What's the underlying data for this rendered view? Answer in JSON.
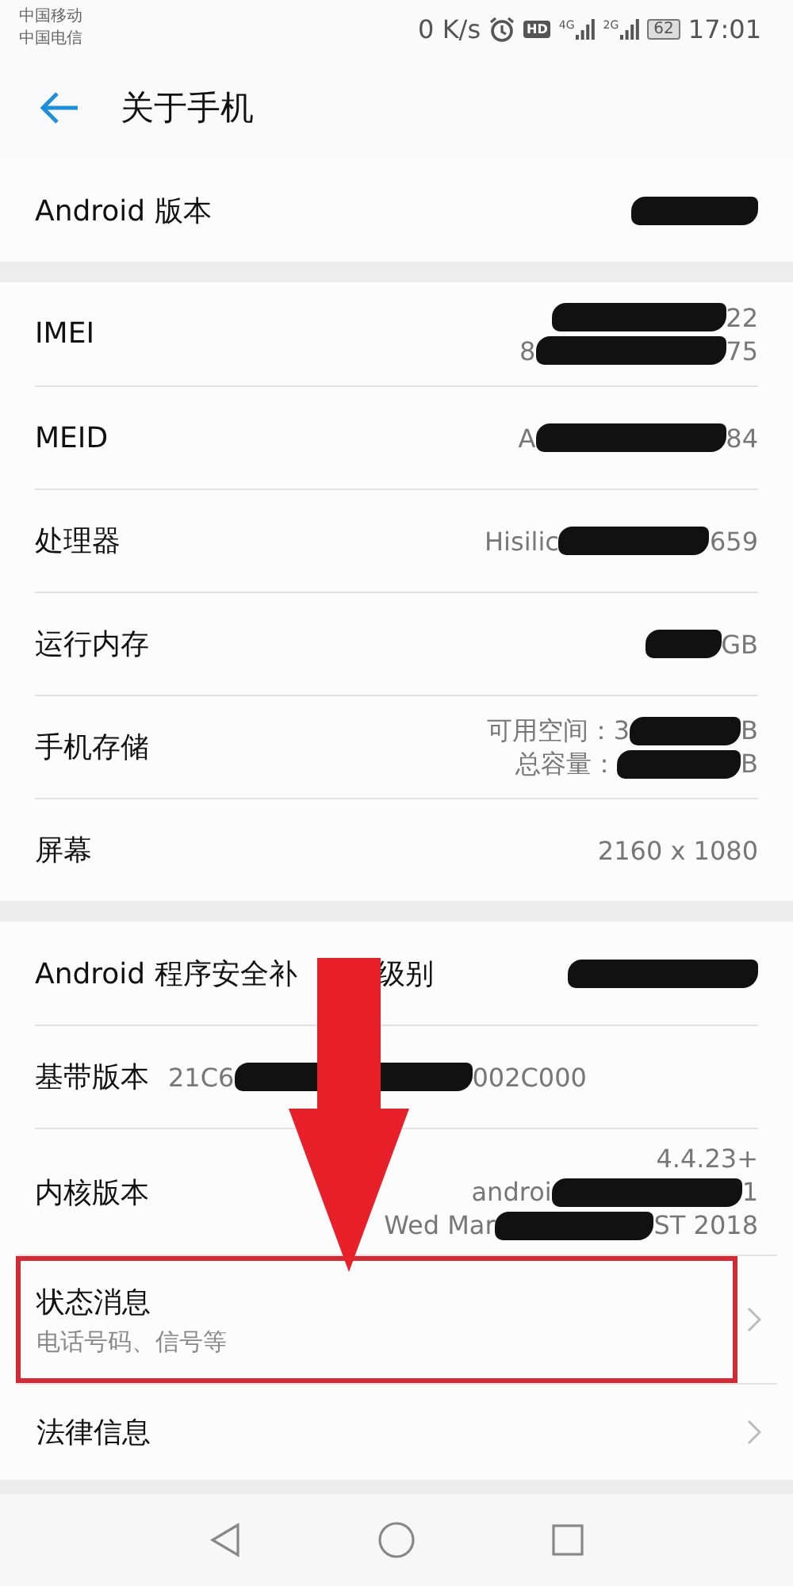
{
  "status_bar": {
    "carriers": [
      "中国移动",
      "中国电信"
    ],
    "speed": "0 K/s",
    "hd_badge": "HD",
    "networks": [
      "4G",
      "2G"
    ],
    "battery": "62",
    "time": "17:01"
  },
  "header": {
    "title": "关于手机"
  },
  "sections": [
    {
      "rows": [
        {
          "kind": "value",
          "label": [
            "Android 版本"
          ],
          "lines": [
            [
              {
                "kind": "redacted"
              }
            ]
          ]
        }
      ]
    },
    {
      "rows": [
        {
          "kind": "value",
          "label": [
            "IMEI"
          ],
          "lines": [
            [
              {
                "kind": "redacted"
              },
              {
                "kind": "text",
                "text": "22"
              }
            ],
            [
              {
                "kind": "text",
                "text": "8"
              },
              {
                "kind": "redacted"
              },
              {
                "kind": "text",
                "text": "75"
              }
            ]
          ]
        },
        {
          "kind": "value",
          "label": [
            "MEID"
          ],
          "lines": [
            [
              {
                "kind": "text",
                "text": "A"
              },
              {
                "kind": "redacted"
              },
              {
                "kind": "text",
                "text": "84"
              }
            ]
          ]
        },
        {
          "kind": "value",
          "label": [
            "处理器"
          ],
          "lines": [
            [
              {
                "kind": "text",
                "text": "Hisilic"
              },
              {
                "kind": "redacted"
              },
              {
                "kind": "text",
                "text": "659"
              }
            ]
          ]
        },
        {
          "kind": "value",
          "label": [
            "运行内存"
          ],
          "lines": [
            [
              {
                "kind": "redacted"
              },
              {
                "kind": "text",
                "text": "GB"
              }
            ]
          ]
        },
        {
          "kind": "value",
          "label": [
            "手机存储"
          ],
          "lines": [
            [
              {
                "kind": "text",
                "text": "可用空间：3"
              },
              {
                "kind": "redacted"
              },
              {
                "kind": "text",
                "text": "B"
              }
            ],
            [
              {
                "kind": "text",
                "text": "总容量："
              },
              {
                "kind": "redacted"
              },
              {
                "kind": "text",
                "text": "B"
              }
            ]
          ]
        },
        {
          "kind": "value",
          "label": [
            "屏幕"
          ],
          "lines": [
            [
              {
                "kind": "text",
                "text": "2160 x 1080"
              }
            ]
          ]
        }
      ]
    },
    {
      "rows": [
        {
          "kind": "value",
          "label": [
            "Android 程序安全补",
            "级别"
          ],
          "lines": [
            [
              {
                "kind": "redacted"
              }
            ]
          ]
        },
        {
          "kind": "inline",
          "label": [
            "基带版本"
          ],
          "lines": [
            [
              {
                "kind": "text",
                "text": "21C6"
              },
              {
                "kind": "redacted"
              },
              {
                "kind": "text",
                "text": "002C000"
              }
            ]
          ]
        },
        {
          "kind": "value",
          "label": [
            "内核版本"
          ],
          "lines": [
            [
              {
                "kind": "text",
                "text": "4.4.23+"
              }
            ],
            [
              {
                "kind": "text",
                "text": "androi"
              },
              {
                "kind": "redacted"
              },
              {
                "kind": "text",
                "text": "1"
              }
            ],
            [
              {
                "kind": "text",
                "text": "Wed Mar "
              },
              {
                "kind": "redacted"
              },
              {
                "kind": "text",
                "text": "ST 2018"
              }
            ]
          ]
        },
        {
          "kind": "link",
          "label": [
            "状态消息"
          ],
          "subtitle": "电话号码、信号等",
          "highlighted": true
        },
        {
          "kind": "link",
          "label": [
            "法律信息"
          ],
          "highlighted": false
        }
      ]
    }
  ]
}
